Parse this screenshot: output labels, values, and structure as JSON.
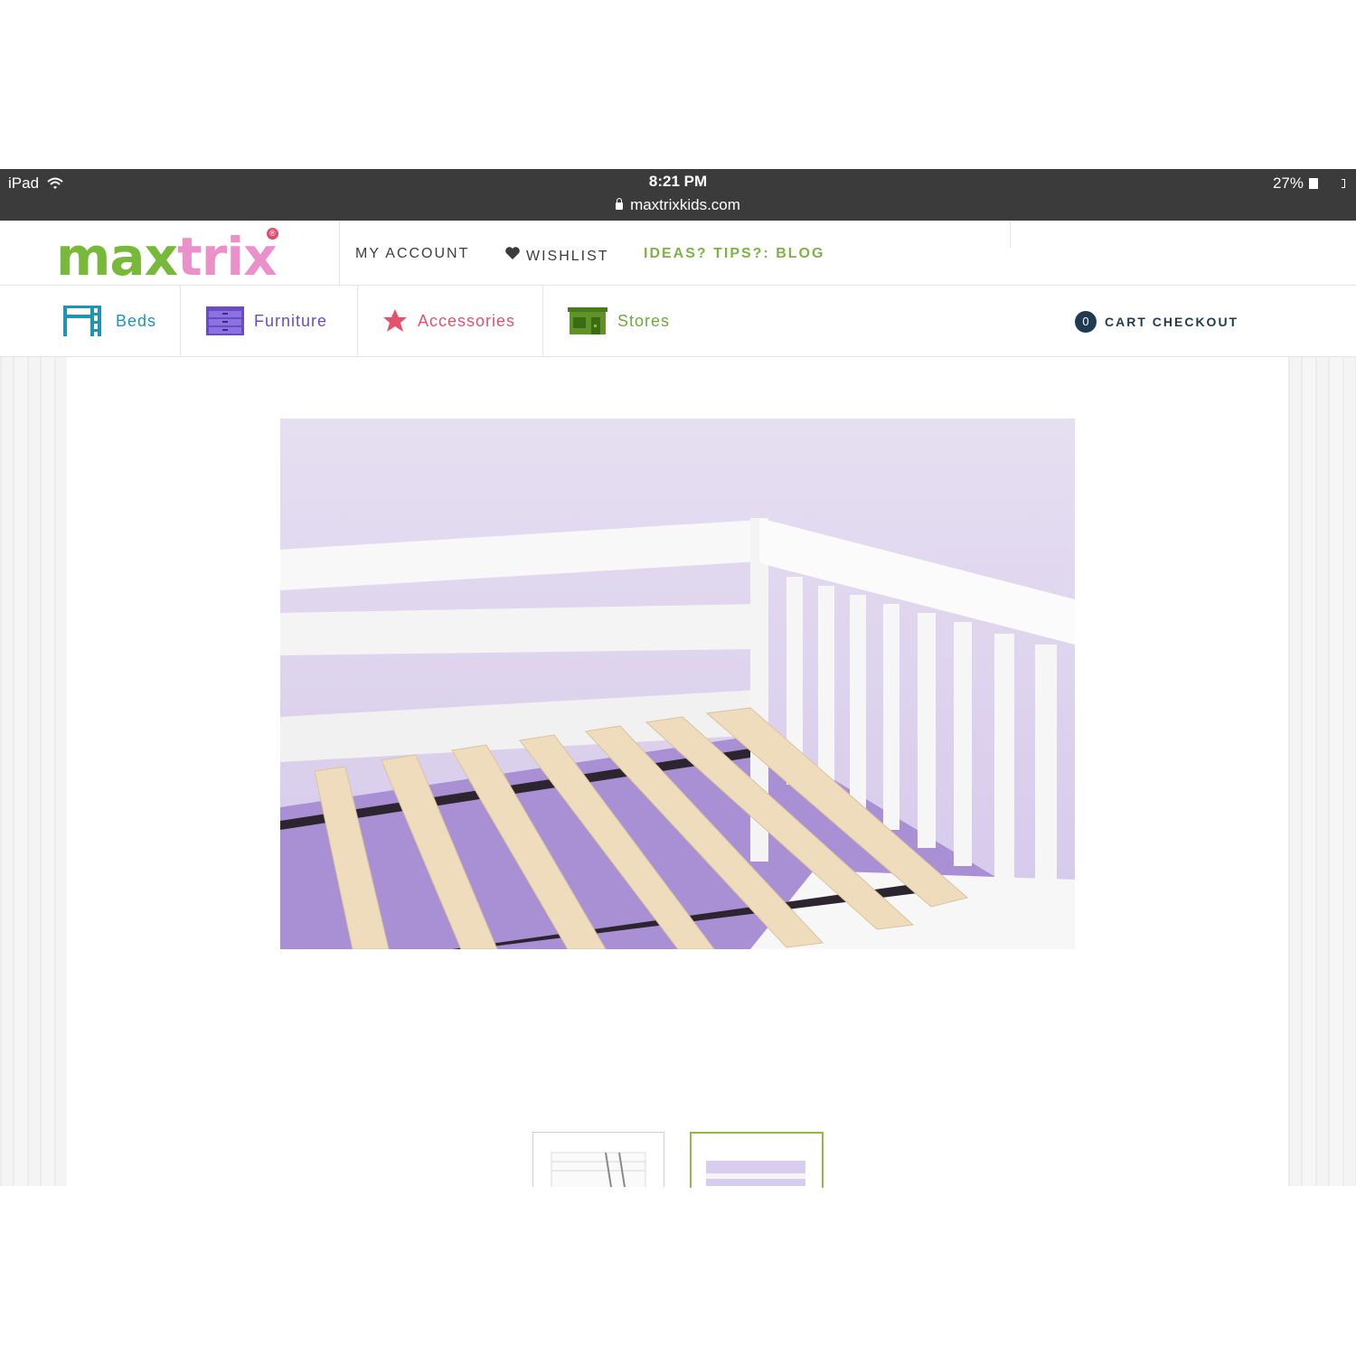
{
  "status_bar": {
    "device": "iPad",
    "time": "8:21 PM",
    "url": "maxtrixkids.com",
    "battery": "27%"
  },
  "header": {
    "logo_part1": "max",
    "logo_part2": "trix",
    "logo_mark": "®",
    "my_account": "MY ACCOUNT",
    "wishlist": "WISHLIST",
    "blog": "IDEAS? TIPS?: BLOG"
  },
  "nav": {
    "beds": "Beds",
    "furniture": "Furniture",
    "accessories": "Accessories",
    "stores": "Stores"
  },
  "cart": {
    "count": "0",
    "label": "CART CHECKOUT"
  },
  "colors": {
    "status_bar": "#3b3b3b",
    "brand_green": "#78b83a",
    "brand_pink": "#e991c8",
    "beds": "#1f95b4",
    "furniture": "#6a4bc4",
    "accessories": "#e6506b",
    "stores": "#6ea93a",
    "cart": "#1e3b52",
    "thumb_active": "#8cbf3f"
  },
  "icons": {
    "wifi": "wifi-icon",
    "lock": "lock-icon",
    "battery": "battery-icon",
    "heart": "heart-icon",
    "beds": "bunk-bed-icon",
    "furniture": "dresser-icon",
    "accessories": "star-icon",
    "stores": "storefront-icon"
  }
}
